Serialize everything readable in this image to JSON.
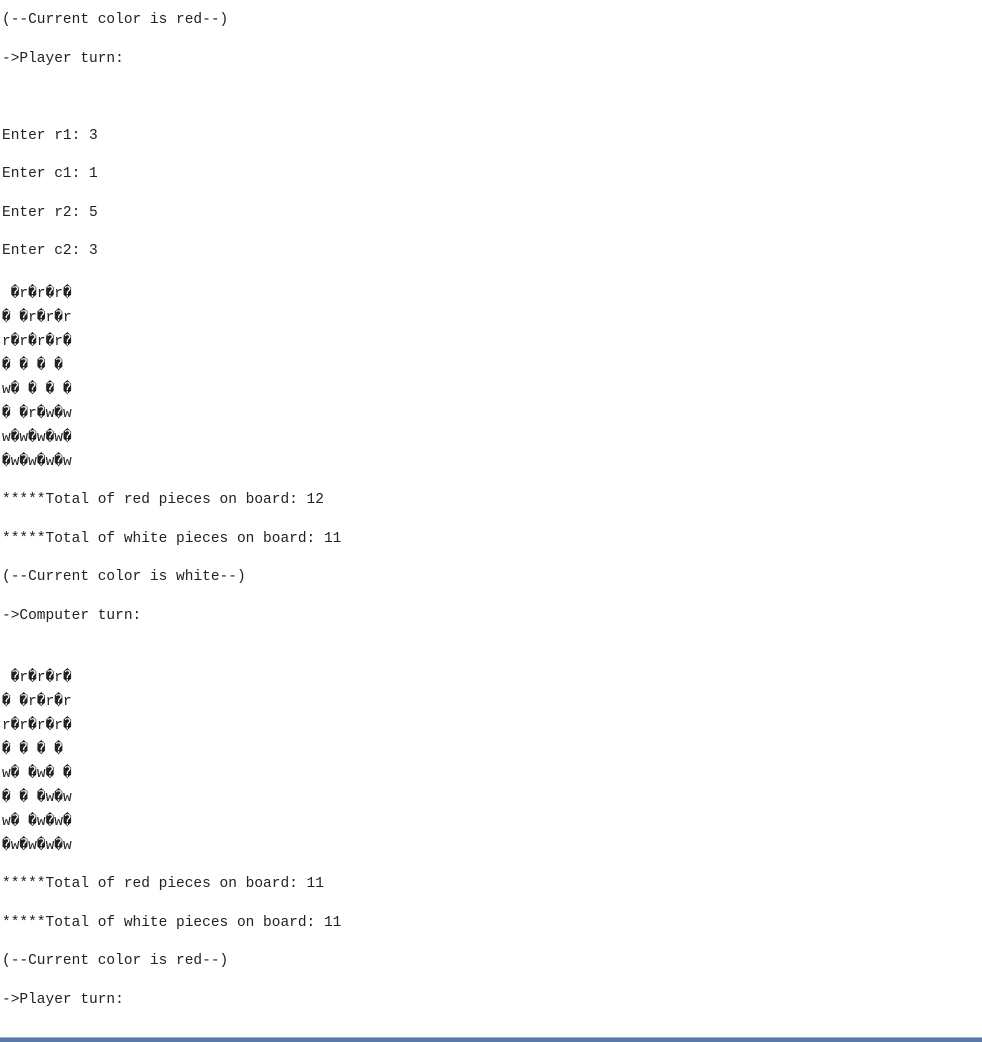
{
  "console": {
    "lines_top": [
      "(--Current color is red--)",
      "->Player turn:"
    ],
    "inputs": [
      "Enter r1: 3",
      "Enter c1: 1",
      "Enter r2: 5",
      "Enter c2: 3"
    ],
    "board1": [
      " �r�r�r�",
      "� �r�r�r",
      "r�r�r�r�",
      "� � � �",
      "w� � � �",
      "� �r�w�w",
      "w�w�w�w�",
      "�w�w�w�w"
    ],
    "totals1": [
      "*****Total of red pieces on board: 12",
      "*****Total of white pieces on board: 11"
    ],
    "mid_lines": [
      "(--Current color is white--)",
      "->Computer turn:"
    ],
    "board2": [
      " �r�r�r�",
      "� �r�r�r",
      "r�r�r�r�",
      "� � � �",
      "w� �w� �",
      "� � �w�w",
      "w� �w�w�",
      "�w�w�w�w"
    ],
    "totals2": [
      "*****Total of red pieces on board: 11",
      "*****Total of white pieces on board: 11"
    ],
    "end_lines": [
      "(--Current color is red--)",
      "->Player turn:"
    ]
  }
}
